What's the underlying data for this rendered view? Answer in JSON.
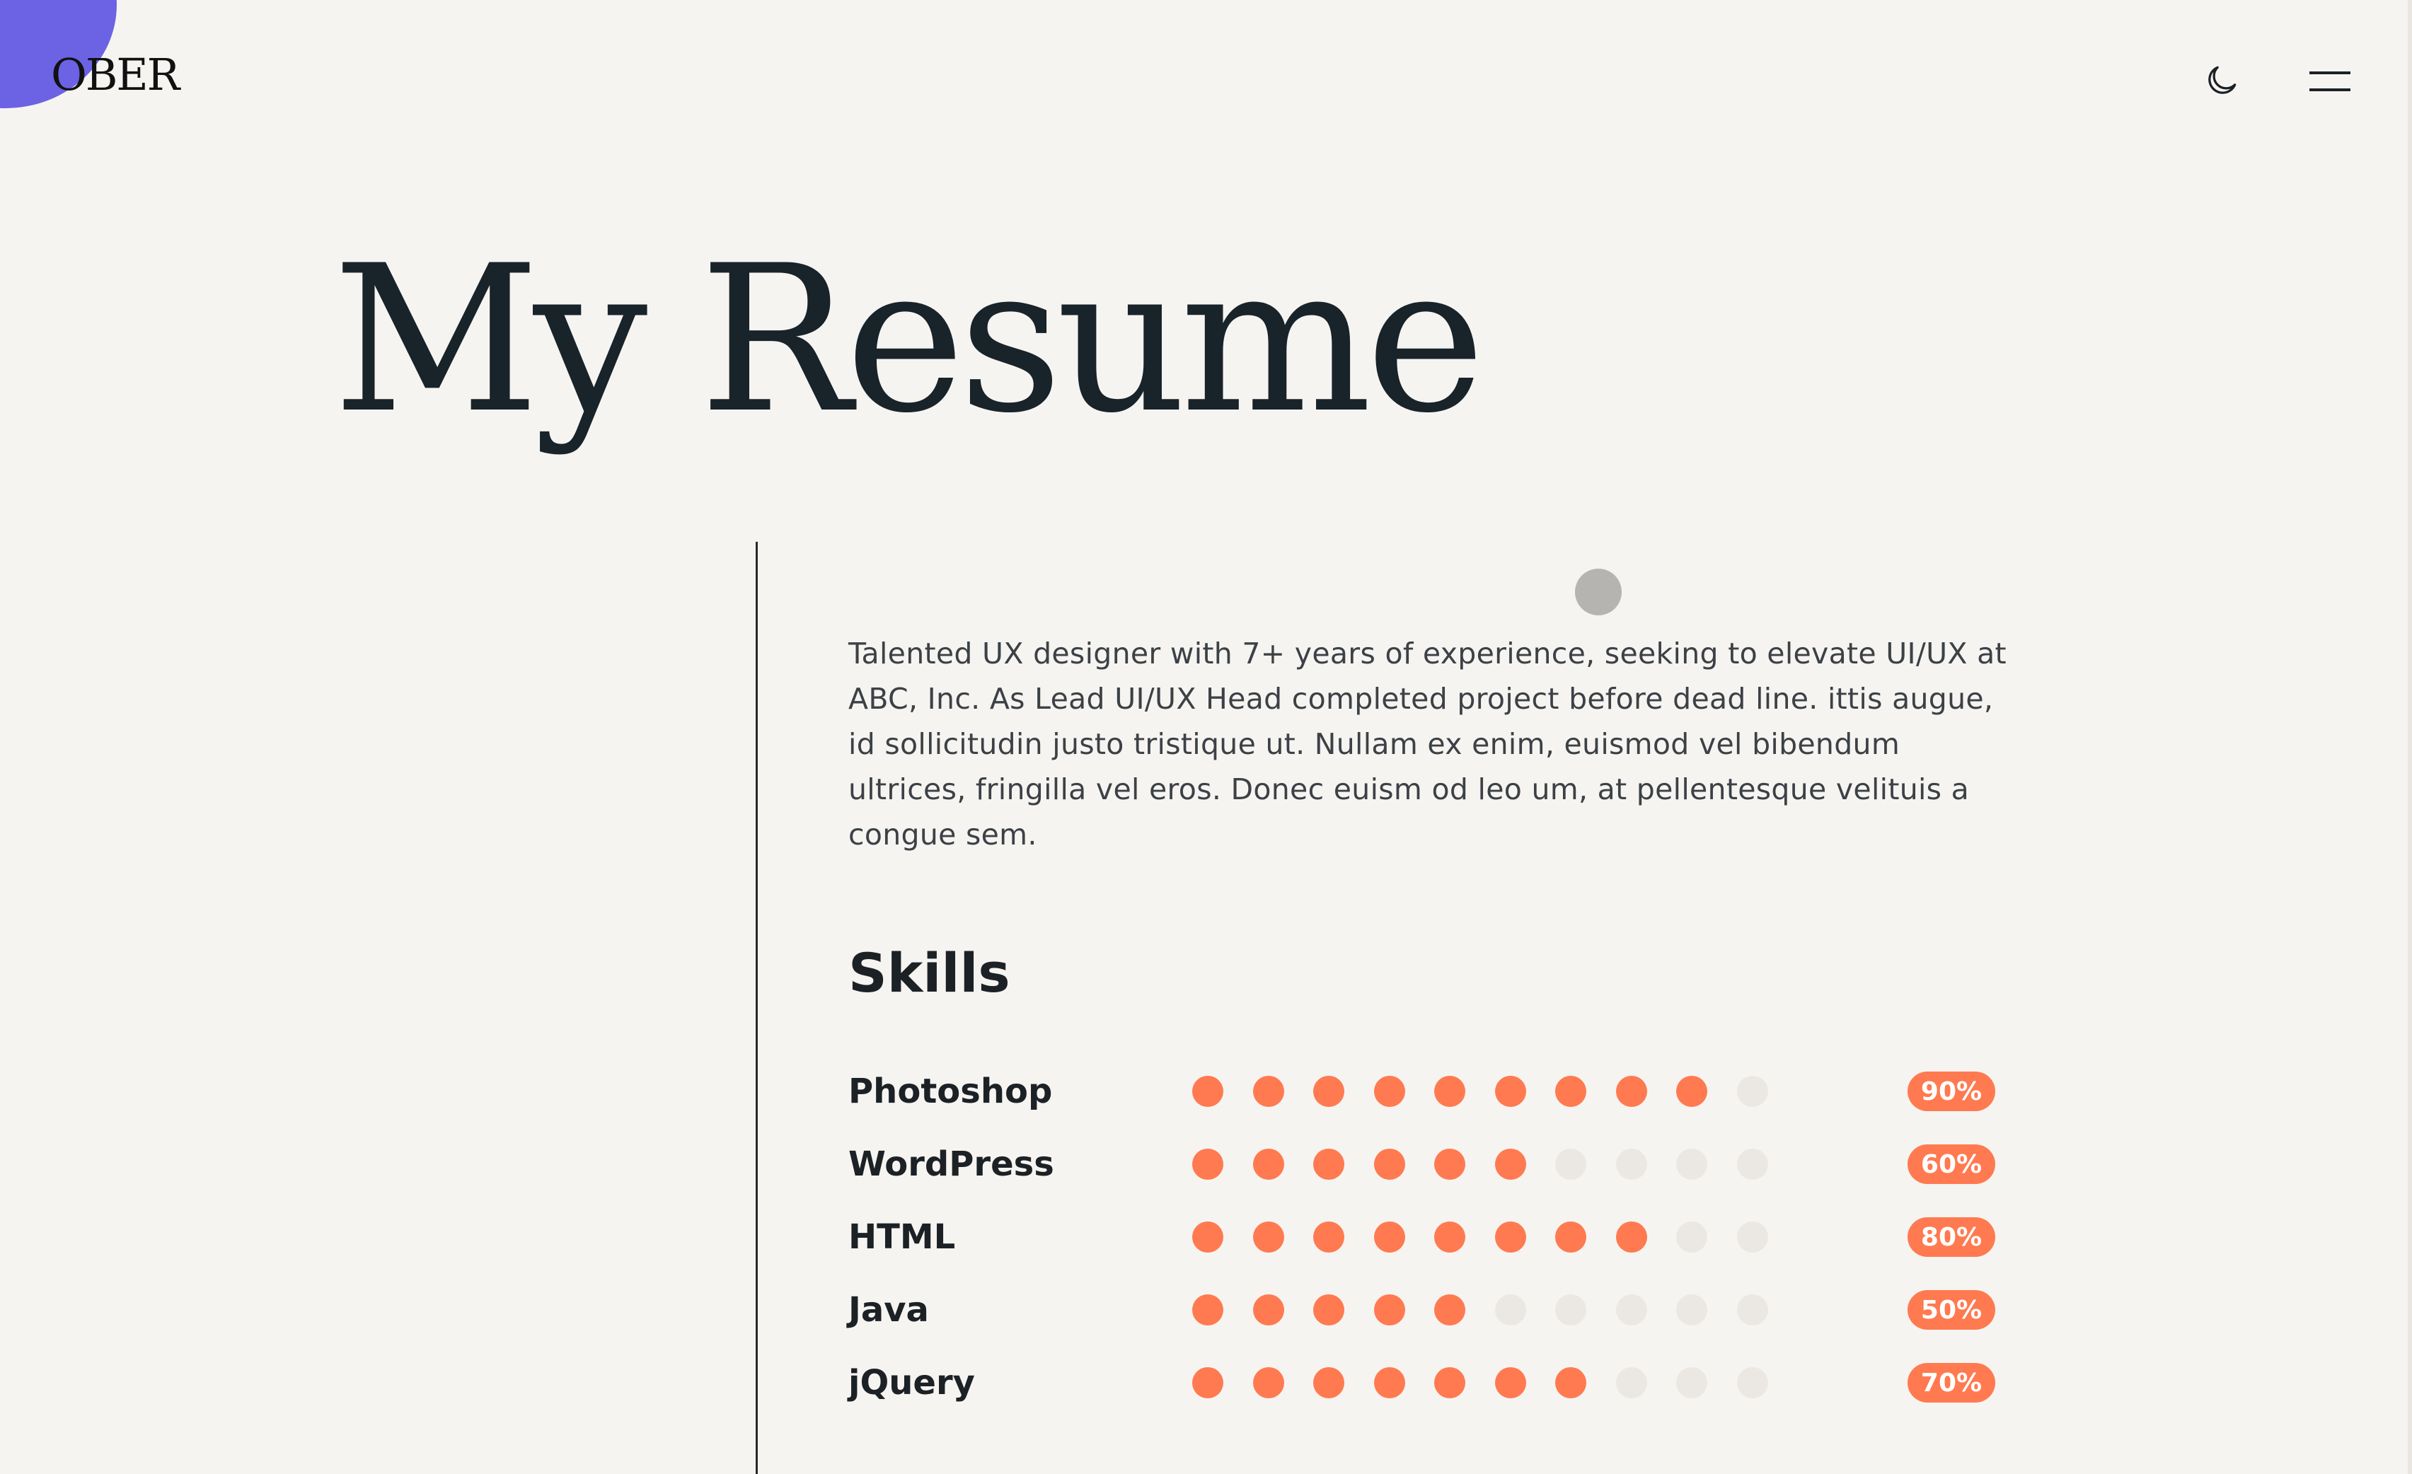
{
  "brand": {
    "logo_text": "OBER",
    "accent": "#6c62e4"
  },
  "header": {
    "theme_toggle_icon": "moon-icon",
    "menu_icon": "hamburger-menu-icon"
  },
  "page": {
    "title": "My Resume"
  },
  "summary": {
    "text": "Talented UX designer with 7+ years of experience, seeking to elevate UI/UX at ABC, Inc. As Lead UI/UX Head completed project before dead line. ittis augue, id sollicitudin justo tristique ut. Nullam ex enim, euismod vel bibendum ultrices, fringilla vel eros. Donec euism od leo um, at pellentesque velituis a congue sem."
  },
  "skills": {
    "heading": "Skills",
    "colors": {
      "filled": "#ff7a50",
      "empty": "#ebe8e4"
    },
    "items": [
      {
        "name": "Photoshop",
        "level": 9,
        "max": 10,
        "percent_label": "90%"
      },
      {
        "name": "WordPress",
        "level": 6,
        "max": 10,
        "percent_label": "60%"
      },
      {
        "name": "HTML",
        "level": 8,
        "max": 10,
        "percent_label": "80%"
      },
      {
        "name": "Java",
        "level": 5,
        "max": 10,
        "percent_label": "50%"
      },
      {
        "name": "jQuery",
        "level": 7,
        "max": 10,
        "percent_label": "70%"
      }
    ]
  }
}
